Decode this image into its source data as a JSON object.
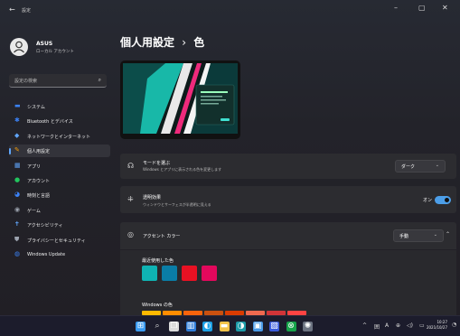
{
  "window": {
    "back_glyph": "←",
    "title": "設定",
    "minimize": "–",
    "maximize": "▢",
    "close": "✕"
  },
  "user": {
    "name": "ASUS",
    "subtitle": "ローカル アカウント"
  },
  "search": {
    "placeholder": "設定の検索"
  },
  "nav": [
    {
      "label": "システム",
      "icon": "monitor-icon",
      "color": "#3b82f6"
    },
    {
      "label": "Bluetooth とデバイス",
      "icon": "bluetooth-icon",
      "color": "#3b82f6"
    },
    {
      "label": "ネットワークとインターネット",
      "icon": "wifi-icon",
      "color": "#60a5fa"
    },
    {
      "label": "個人用設定",
      "icon": "pencil-icon",
      "color": "#f59e0b",
      "active": true
    },
    {
      "label": "アプリ",
      "icon": "apps-icon",
      "color": "#60a5fa"
    },
    {
      "label": "アカウント",
      "icon": "person-icon",
      "color": "#22c55e"
    },
    {
      "label": "時刻と言語",
      "icon": "globe-clock-icon",
      "color": "#3b82f6"
    },
    {
      "label": "ゲーム",
      "icon": "controller-icon",
      "color": "#9ca3af"
    },
    {
      "label": "アクセシビリティ",
      "icon": "accessibility-icon",
      "color": "#60a5fa"
    },
    {
      "label": "プライバシーとセキュリティ",
      "icon": "shield-icon",
      "color": "#9ca3af"
    },
    {
      "label": "Windows Update",
      "icon": "update-icon",
      "color": "#3b82f6"
    }
  ],
  "main": {
    "breadcrumb_parent": "個人用設定",
    "breadcrumb_sep": "›",
    "breadcrumb_current": "色",
    "mode": {
      "title": "モードを選ぶ",
      "desc": "Windows とアプリに表示される色を変更します",
      "value": "ダーク"
    },
    "transparency": {
      "title": "透明効果",
      "desc": "ウィンドウとサーフェスが半透明に見える",
      "value": "オン",
      "on": true
    },
    "accent": {
      "title": "アクセント カラー",
      "value": "手動",
      "recent_label": "最近使用した色",
      "recent_colors": [
        "#0fb3b3",
        "#0a7da6",
        "#e81123",
        "#e3085c"
      ],
      "windows_label": "Windows の色",
      "windows_colors": [
        "#ffb900",
        "#ff8c00",
        "#f7630c",
        "#ca5010",
        "#da3b01",
        "#ef6950",
        "#d13438",
        "#ff4343"
      ]
    }
  },
  "taskbar": {
    "icons": [
      "windows-start-icon",
      "search-icon",
      "task-view-icon",
      "widgets-icon",
      "edge-icon",
      "file-explorer-icon",
      "edge-dev-icon",
      "store-icon",
      "photos-icon",
      "xbox-icon",
      "settings-icon"
    ],
    "tray": {
      "chevron": "^",
      "ime1": "囲",
      "ime2": "A"
    },
    "time": "10:27",
    "date": "2021/10/27"
  }
}
